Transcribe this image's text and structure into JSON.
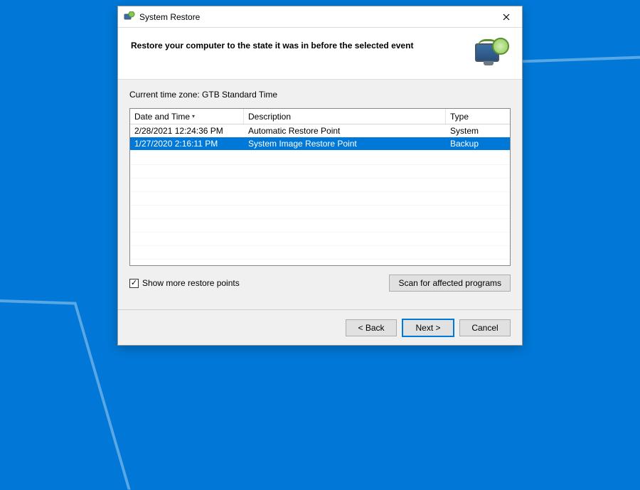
{
  "window": {
    "title": "System Restore"
  },
  "banner": {
    "heading": "Restore your computer to the state it was in before the selected event"
  },
  "timezone_label": "Current time zone: GTB Standard Time",
  "table": {
    "columns": {
      "date": "Date and Time",
      "desc": "Description",
      "type": "Type"
    },
    "rows": [
      {
        "date": "2/28/2021 12:24:36 PM",
        "desc": "Automatic Restore Point",
        "type": "System",
        "selected": false
      },
      {
        "date": "1/27/2020 2:16:11 PM",
        "desc": "System Image Restore Point",
        "type": "Backup",
        "selected": true
      }
    ]
  },
  "checkbox": {
    "label": "Show more restore points",
    "checked": true
  },
  "buttons": {
    "scan": "Scan for affected programs",
    "back": "< Back",
    "next": "Next >",
    "cancel": "Cancel"
  }
}
